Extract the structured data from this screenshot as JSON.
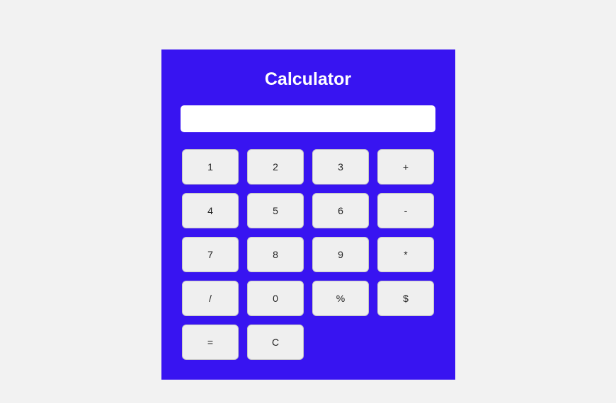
{
  "title": "Calculator",
  "display_value": "",
  "keys": {
    "k1": "1",
    "k2": "2",
    "k3": "3",
    "plus": "+",
    "k4": "4",
    "k5": "5",
    "k6": "6",
    "minus": "-",
    "k7": "7",
    "k8": "8",
    "k9": "9",
    "multiply": "*",
    "divide": "/",
    "k0": "0",
    "percent": "%",
    "dollar": "$",
    "equals": "=",
    "clear": "C"
  }
}
